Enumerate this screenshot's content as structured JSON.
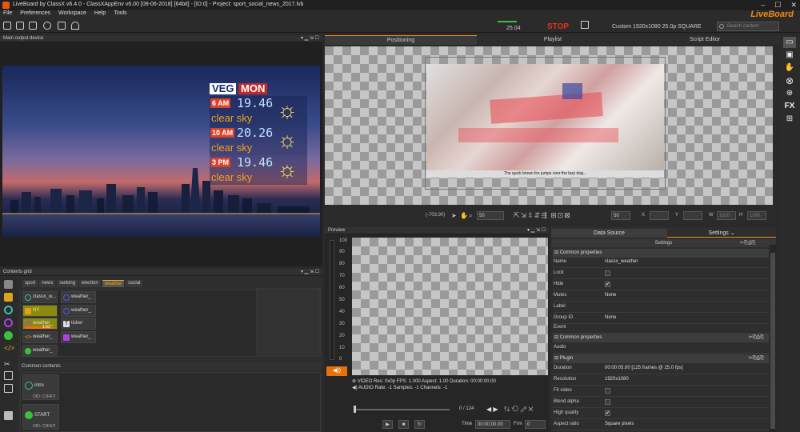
{
  "window": {
    "title": "LiveBoard by ClassX v6.4.0 - ClassXAppEnv v6.00 [08-06-2018]  [64bit] - [ID:0] - Project: sport_social_news_2017.lvb",
    "controls": [
      "–",
      "☐",
      "✕"
    ]
  },
  "menu": [
    "File",
    "Preferences",
    "Workspace",
    "Help",
    "Tools"
  ],
  "brand": "LiveBoard",
  "toolbar": {
    "stop_label": "STOP",
    "fps": "25.04",
    "format": "Custom 1920x1080 25.0p SQUARE",
    "search_placeholder": "Search content"
  },
  "main_output": {
    "title": "Main output device",
    "weather": {
      "day1": "VEG",
      "day2": "MON",
      "rows": [
        {
          "time": "6 AM",
          "temp": "19.46",
          "cond": "clear sky"
        },
        {
          "time": "10 AM",
          "temp": "20.26",
          "cond": "clear sky"
        },
        {
          "time": "3 PM",
          "temp": "19.46",
          "cond": "clear sky"
        }
      ]
    }
  },
  "contents_grid": {
    "title": "Contents grid",
    "tabs": [
      "sport",
      "news",
      "ranking",
      "election",
      "weather",
      "social"
    ],
    "active_tab": "weather",
    "cells": [
      "classx_w...",
      "weather_",
      "NY",
      "weather_",
      "weather_",
      "ticker",
      "weather_",
      "weather_",
      "weather_"
    ],
    "cell_badge": "1:02"
  },
  "common_contents": {
    "title": "Common contents",
    "items": [
      {
        "label": "intro",
        "id": "OID: C3FA7I"
      },
      {
        "label": "START",
        "id": "OID: C3FA7I"
      }
    ]
  },
  "center_tabs": [
    "Positioning",
    "Playlist",
    "Script Editor"
  ],
  "canvas": {
    "caption": "The quick brown fox jumps over the lazy dog..."
  },
  "coordbar": {
    "pos": "(-703,90)",
    "zoom": "50",
    "zoom2": "50",
    "labels": [
      "X",
      "Y",
      "W",
      "H"
    ],
    "w": "1920",
    "h": "1080"
  },
  "preview": {
    "title": "Preview",
    "ruler": [
      "100",
      "90",
      "80",
      "70",
      "60",
      "50",
      "40",
      "30",
      "20",
      "10",
      "0"
    ],
    "video_line": "VIDEO Res: 0x0p FPS: 1.000 Aspect: 1.00 Duration: 00:00:00.00",
    "audio_line": "AUDIO Rate: -1 Samples: -1 Channels: -1",
    "frame_count": "0 / 124",
    "time_label": "Time",
    "time_value": "00:00:00.00",
    "frm_label": "Frm",
    "frm_value": "0"
  },
  "right_panel": {
    "tabs": [
      "Data Source",
      "Settings"
    ],
    "subtitle": "Settings",
    "rows": [
      {
        "type": "section",
        "label": "Common properties"
      },
      {
        "type": "text",
        "k": "Name",
        "v": "classx_weather"
      },
      {
        "type": "check",
        "k": "Lock",
        "v": ""
      },
      {
        "type": "check",
        "k": "Hide",
        "v": "✔"
      },
      {
        "type": "text",
        "k": "Mutex",
        "v": "None"
      },
      {
        "type": "text",
        "k": "Label",
        "v": ""
      },
      {
        "type": "text",
        "k": "Group ID",
        "v": "None"
      },
      {
        "type": "text",
        "k": "Event",
        "v": ""
      },
      {
        "type": "section",
        "label": "Common properties"
      },
      {
        "type": "text",
        "k": "Audio",
        "v": ""
      },
      {
        "type": "section",
        "label": "Plugin"
      },
      {
        "type": "text",
        "k": "Duration",
        "v": "00:00:05.00 [125 frames @ 25.0 fps]"
      },
      {
        "type": "text",
        "k": "Resolution",
        "v": "1920x1080"
      },
      {
        "type": "check",
        "k": "Fit video",
        "v": ""
      },
      {
        "type": "check",
        "k": "Blend alpha",
        "v": ""
      },
      {
        "type": "check",
        "k": "High quality",
        "v": "✔"
      },
      {
        "type": "text",
        "k": "Aspect ratio",
        "v": "Square pixels"
      }
    ]
  },
  "sidebar_icons": [
    "monitor-icon",
    "terminal-icon",
    "hand-icon",
    "close-circle-icon",
    "gamepad-icon",
    "fx-icon",
    "grid-icon"
  ],
  "colors": {
    "accent": "#f08a12",
    "stop": "#e8331a"
  }
}
